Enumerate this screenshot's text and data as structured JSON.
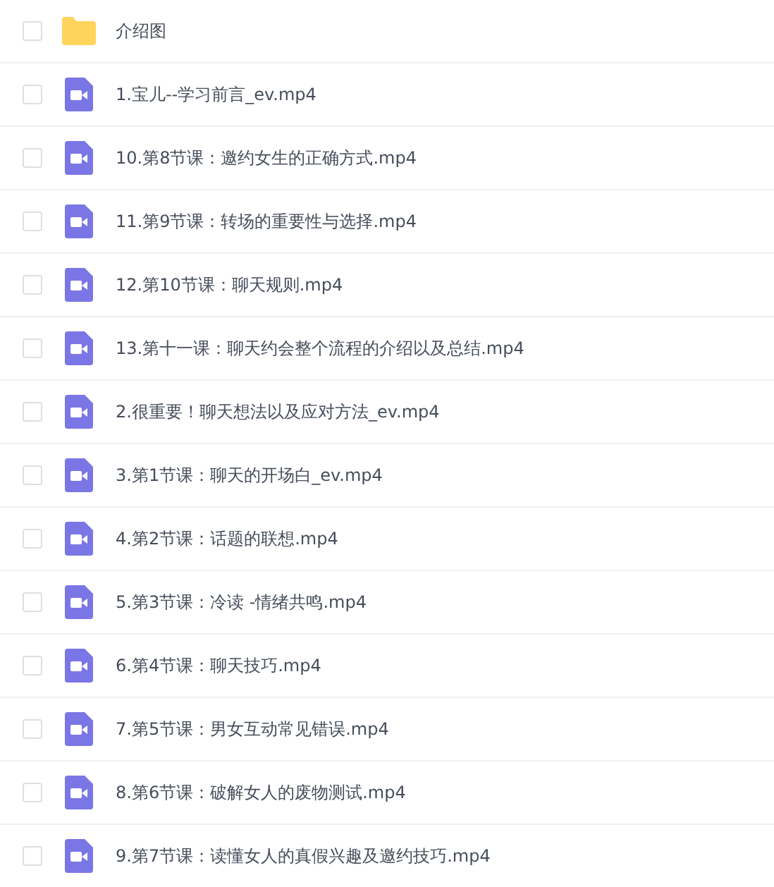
{
  "files": [
    {
      "kind": "folder",
      "name": "介绍图",
      "checked": false
    },
    {
      "kind": "video",
      "name": "1.宝儿--学习前言_ev.mp4",
      "checked": false
    },
    {
      "kind": "video",
      "name": "10.第8节课：邀约女生的正确方式.mp4",
      "checked": false
    },
    {
      "kind": "video",
      "name": "11.第9节课：转场的重要性与选择.mp4",
      "checked": false
    },
    {
      "kind": "video",
      "name": "12.第10节课：聊天规则.mp4",
      "checked": false
    },
    {
      "kind": "video",
      "name": "13.第十一课：聊天约会整个流程的介绍以及总结.mp4",
      "checked": false
    },
    {
      "kind": "video",
      "name": "2.很重要！聊天想法以及应对方法_ev.mp4",
      "checked": false
    },
    {
      "kind": "video",
      "name": "3.第1节课：聊天的开场白_ev.mp4",
      "checked": false
    },
    {
      "kind": "video",
      "name": "4.第2节课：话题的联想.mp4",
      "checked": false
    },
    {
      "kind": "video",
      "name": "5.第3节课：冷读 -情绪共鸣.mp4",
      "checked": false
    },
    {
      "kind": "video",
      "name": "6.第4节课：聊天技巧.mp4",
      "checked": false
    },
    {
      "kind": "video",
      "name": "7.第5节课：男女互动常见错误.mp4",
      "checked": false
    },
    {
      "kind": "video",
      "name": "8.第6节课：破解女人的废物测试.mp4",
      "checked": false
    },
    {
      "kind": "video",
      "name": "9.第7节课：读懂女人的真假兴趣及邀约技巧.mp4",
      "checked": false
    }
  ]
}
